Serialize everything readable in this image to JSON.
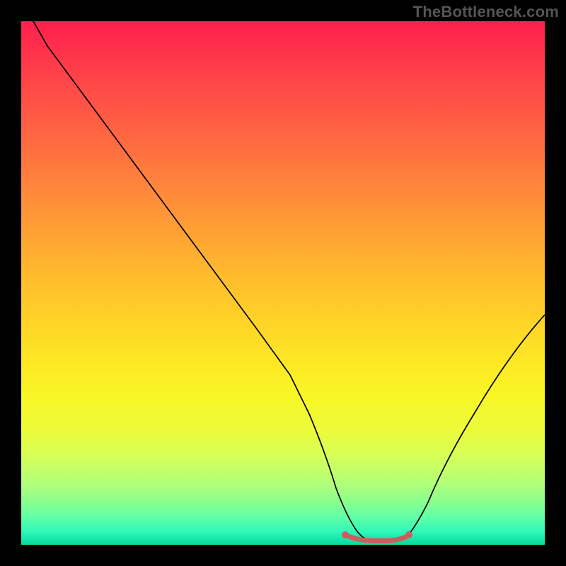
{
  "watermark": "TheBottleneck.com",
  "chart_data": {
    "type": "line",
    "title": "",
    "xlabel": "",
    "ylabel": "",
    "xlim": [
      0,
      100
    ],
    "ylim": [
      0,
      100
    ],
    "grid": false,
    "legend": false,
    "description": "V-shaped bottleneck curve on rainbow gradient background; minimum plateau near x≈64–73, right branch rises to ~37 at x=100",
    "series": [
      {
        "name": "bottleneck-curve",
        "x": [
          0,
          5,
          10,
          15,
          20,
          25,
          30,
          35,
          40,
          45,
          50,
          55,
          58,
          60,
          62,
          64,
          66,
          68,
          70,
          72,
          74,
          76,
          80,
          85,
          90,
          95,
          100
        ],
        "y": [
          104,
          96,
          88,
          80,
          72,
          64,
          56,
          48,
          40,
          32,
          24,
          16,
          11,
          8,
          5,
          3,
          1.5,
          1,
          1,
          1.2,
          2,
          3.5,
          8,
          15,
          22,
          30,
          37
        ]
      }
    ],
    "plateau": {
      "x_start": 62,
      "x_end": 73,
      "y": 1
    },
    "background_gradient": {
      "top": "#ff1f4f",
      "upper_mid": "#ff9a36",
      "mid": "#fdea24",
      "lower_mid": "#b4ff77",
      "bottom": "#0bdc9e"
    }
  }
}
